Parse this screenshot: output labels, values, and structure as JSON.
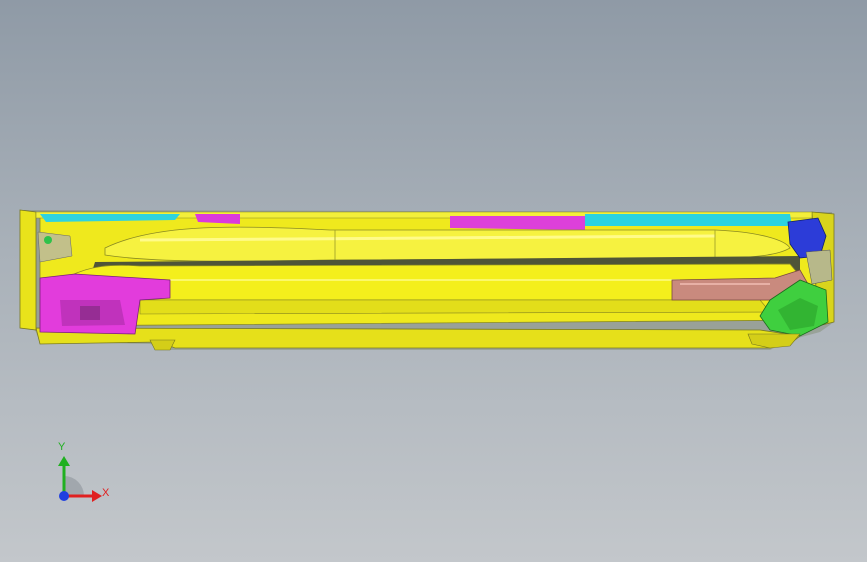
{
  "triad": {
    "x_label": "X",
    "y_label": "Y"
  },
  "colors": {
    "background_top": "#8f9aa6",
    "background_bottom": "#c3c7cb",
    "body_yellow": "#f2ee1a",
    "part_magenta": "#e23cdc",
    "part_cyan": "#2ad3e0",
    "part_green": "#3fcf3f",
    "part_blue": "#2c3cd8",
    "part_salmon": "#c98a7e",
    "axis_x": "#e02020",
    "axis_y": "#20b020",
    "axis_z": "#2040e0"
  },
  "model": {
    "description": ""
  }
}
